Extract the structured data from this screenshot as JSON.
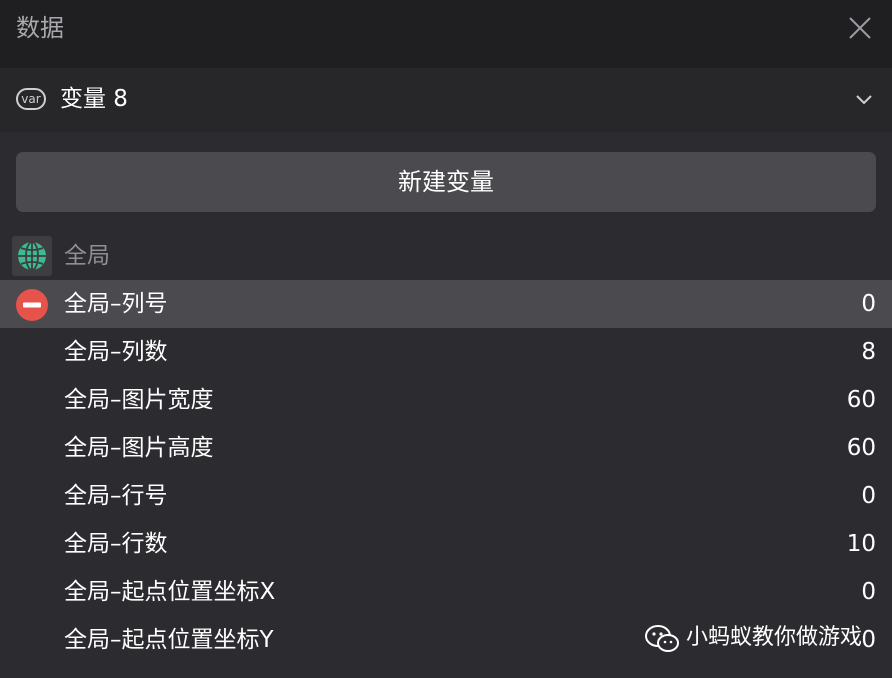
{
  "header": {
    "title": "数据"
  },
  "variable_select": {
    "icon": "var-icon",
    "icon_text": "var",
    "value": "变量 8"
  },
  "new_variable_button": {
    "label": "新建变量"
  },
  "scope": {
    "icon": "globe-icon",
    "label": "全局"
  },
  "variables": [
    {
      "name": "全局–列号",
      "value": "0",
      "selected": true
    },
    {
      "name": "全局–列数",
      "value": "8"
    },
    {
      "name": "全局–图片宽度",
      "value": "60"
    },
    {
      "name": "全局–图片高度",
      "value": "60"
    },
    {
      "name": "全局–行号",
      "value": "0"
    },
    {
      "name": "全局–行数",
      "value": "10"
    },
    {
      "name": "全局–起点位置坐标X",
      "value": "0"
    },
    {
      "name": "全局–起点位置坐标Y",
      "value": "0"
    }
  ],
  "watermark": {
    "icon": "wechat-icon",
    "text": "小蚂蚁教你做游戏"
  },
  "colors": {
    "delete_red": "#e5534b",
    "globe_green": "#3dba8f",
    "selected_row": "#4a4a4f"
  }
}
